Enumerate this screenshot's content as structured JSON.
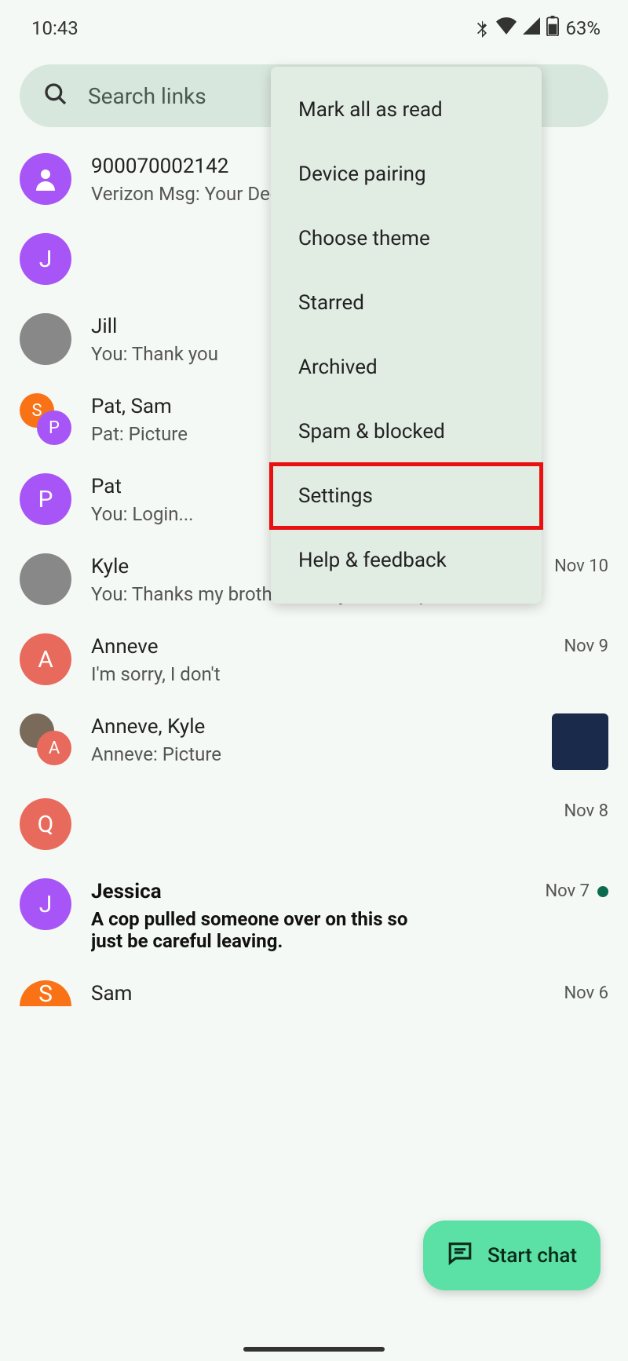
{
  "status": {
    "time": "10:43",
    "battery": "63%"
  },
  "search": {
    "placeholder": "Search links"
  },
  "conversations": [
    {
      "avatar_type": "icon",
      "avatar_color": "purple",
      "title": "900070002142",
      "preview": "Verizon Msg: Your Dec",
      "date": ""
    },
    {
      "avatar_type": "letter",
      "avatar_letter": "J",
      "avatar_color": "purple",
      "title": "",
      "preview": "",
      "date": ""
    },
    {
      "avatar_type": "photo",
      "title": "Jill",
      "preview": "You: Thank you",
      "date": ""
    },
    {
      "avatar_type": "pair",
      "a1_letter": "S",
      "a1_color": "orange",
      "a2_letter": "P",
      "a2_color": "purple",
      "title": "Pat, Sam",
      "preview": "Pat: Picture",
      "date": ""
    },
    {
      "avatar_type": "letter",
      "avatar_letter": "P",
      "avatar_color": "purple",
      "title": "Pat",
      "preview": "You: Login...",
      "date": ""
    },
    {
      "avatar_type": "photo",
      "title": "Kyle",
      "preview": "You: Thanks my brother. Today ended up raini...",
      "date": "Nov 10"
    },
    {
      "avatar_type": "letter",
      "avatar_letter": "A",
      "avatar_color": "coral",
      "title": "Anneve",
      "preview": "I'm sorry, I don't",
      "date": "Nov 9"
    },
    {
      "avatar_type": "pair",
      "a1_photo": true,
      "a2_letter": "A",
      "a2_color": "coral",
      "title": "Anneve, Kyle",
      "preview": "Anneve: Picture",
      "date": "",
      "thumb": true
    },
    {
      "avatar_type": "letter",
      "avatar_letter": "Q",
      "avatar_color": "coral",
      "title": "",
      "preview": "",
      "date": "Nov 8"
    },
    {
      "avatar_type": "letter",
      "avatar_letter": "J",
      "avatar_color": "purple",
      "title": "Jessica",
      "preview": "A cop pulled someone over on this so just be careful leaving.",
      "date": "Nov 7",
      "unread": true,
      "bold": true
    },
    {
      "avatar_type": "half",
      "avatar_letter": "S",
      "avatar_color": "orange",
      "title": "Sam",
      "preview": "",
      "date": "Nov 6"
    }
  ],
  "menu": {
    "items": [
      "Mark all as read",
      "Device pairing",
      "Choose theme",
      "Starred",
      "Archived",
      "Spam & blocked",
      "Settings",
      "Help & feedback"
    ],
    "highlighted_index": 6
  },
  "fab": {
    "label": "Start chat"
  }
}
